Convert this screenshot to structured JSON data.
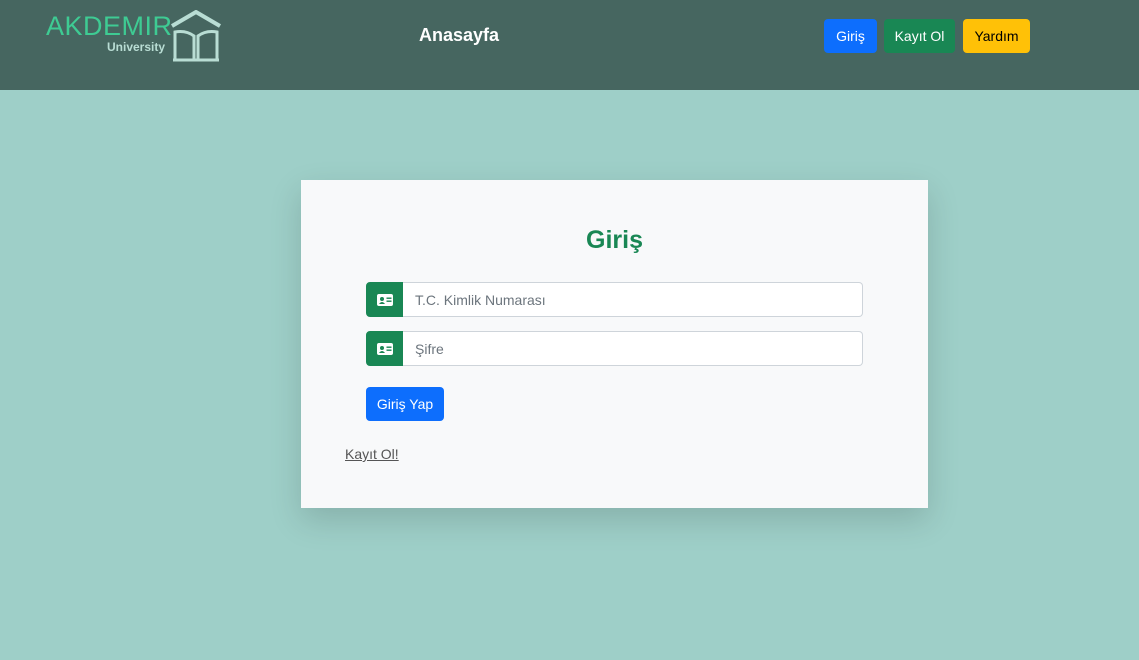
{
  "brand": {
    "name": "AKDEMIR",
    "subtitle": "University"
  },
  "nav": {
    "home": "Anasayfa",
    "login_button": "Giriş",
    "register_button": "Kayıt Ol",
    "help_button": "Yardım"
  },
  "form": {
    "title": "Giriş",
    "tc_placeholder": "T.C. Kimlik Numarası",
    "tc_value": "",
    "password_placeholder": "Şifre",
    "password_value": "",
    "submit_label": "Giriş Yap",
    "register_link": "Kayıt Ol!"
  },
  "icons": {
    "brand": "book-house-logo-icon",
    "input": "id-card-icon"
  },
  "colors": {
    "navbar": "#466660",
    "background": "#9ecfc8",
    "primary": "#0d6efd",
    "success": "#198754",
    "warning": "#ffc107",
    "brand": "#3ecb93"
  }
}
